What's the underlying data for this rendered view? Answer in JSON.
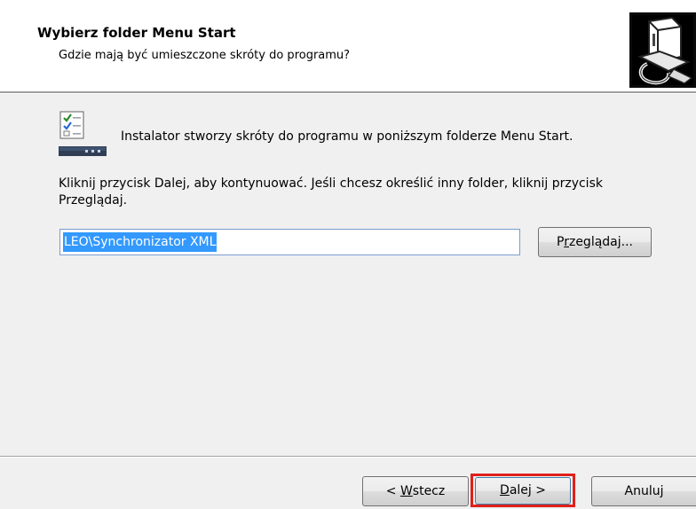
{
  "header": {
    "title": "Wybierz folder Menu Start",
    "subtitle": "Gdzie mają być umieszczone skróty do programu?"
  },
  "content": {
    "intro": "Instalator stworzy skróty do programu w poniższym folderze Menu Start.",
    "instructions": "Kliknij przycisk Dalej, aby kontynuować. Jeśli chcesz określić inny folder, kliknij przycisk Przeglądaj.",
    "folder_value": "LEO\\Synchronizator XML",
    "browse_pre": "P",
    "browse_ul": "r",
    "browse_post": "zeglądaj..."
  },
  "footer": {
    "back_pre": "< ",
    "back_ul": "W",
    "back_post": "stecz",
    "next_ul": "D",
    "next_post": "alej >",
    "cancel_label": "Anuluj"
  },
  "colors": {
    "selection": "#3399ff",
    "highlight_frame": "#e0201b"
  },
  "icons": {
    "header_logo": "computer-box-icon",
    "content_icon": "start-menu-checklist-icon"
  }
}
